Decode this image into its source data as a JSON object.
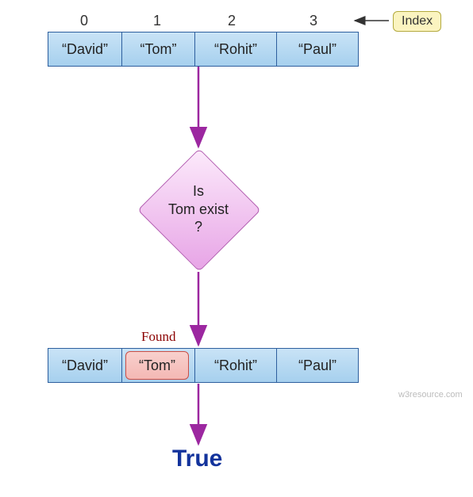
{
  "indices": [
    "0",
    "1",
    "2",
    "3"
  ],
  "array": [
    "“David”",
    "“Tom”",
    "“Rohit”",
    "“Paul”"
  ],
  "index_tag": "Index",
  "decision": {
    "line1": "Is",
    "line2": "Tom exist",
    "line3": "?"
  },
  "found_label": "Found",
  "highlight_value": "“Tom”",
  "result_text": "True",
  "watermark": "w3resource.com",
  "chart_data": {
    "type": "flow-diagram",
    "input_array": [
      "David",
      "Tom",
      "Rohit",
      "Paul"
    ],
    "indices": [
      0,
      1,
      2,
      3
    ],
    "decision": "Is Tom exist ?",
    "found_index": 1,
    "found_value": "Tom",
    "result": true
  }
}
